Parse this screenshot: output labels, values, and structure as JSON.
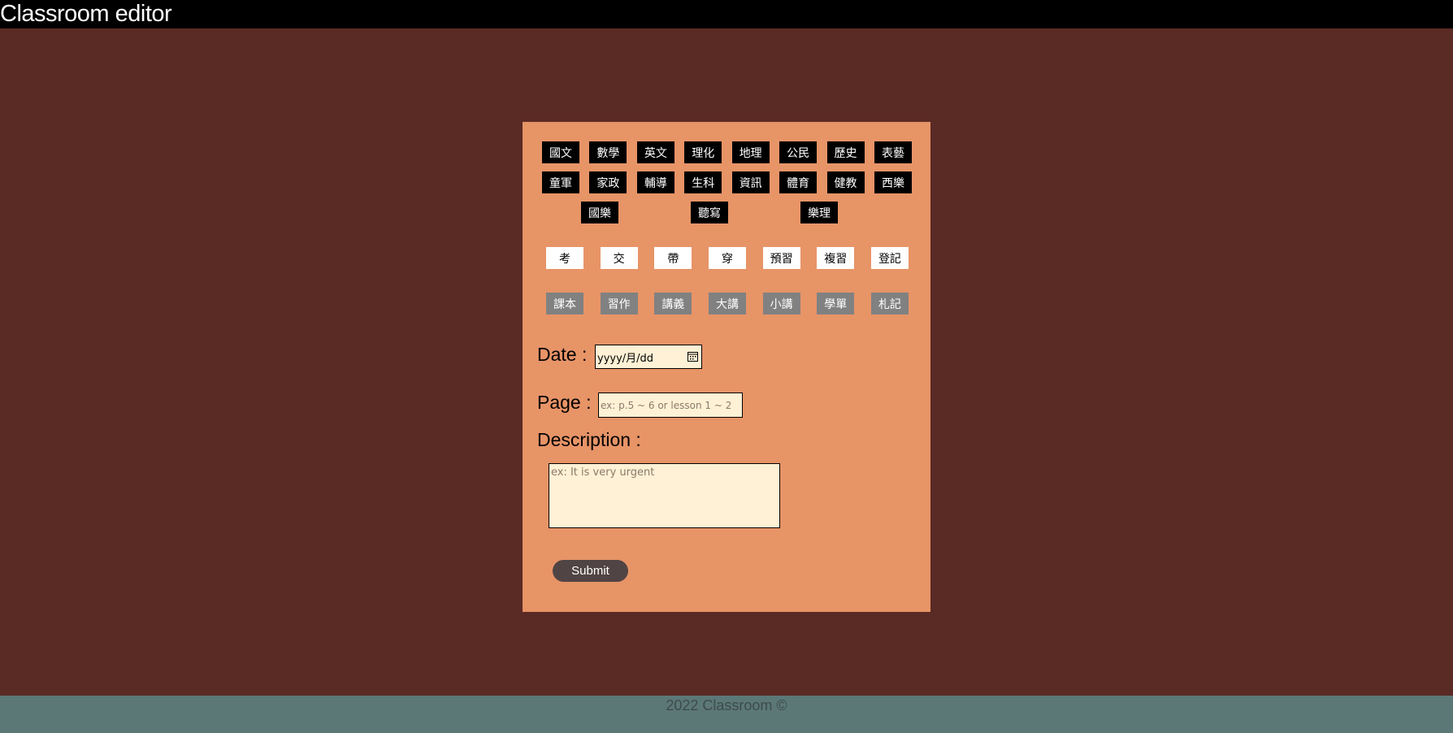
{
  "header": {
    "title": "Classroom editor"
  },
  "subjects": {
    "row1": [
      "國文",
      "數學",
      "英文",
      "理化",
      "地理",
      "公民",
      "歷史",
      "表藝"
    ],
    "row2": [
      "童軍",
      "家政",
      "輔導",
      "生科",
      "資訊",
      "體育",
      "健教",
      "西樂"
    ],
    "row3": [
      "國樂",
      "聽寫",
      "樂理"
    ]
  },
  "actions": [
    "考",
    "交",
    "帶",
    "穿",
    "預習",
    "複習",
    "登記"
  ],
  "items": [
    "課本",
    "習作",
    "講義",
    "大講",
    "小講",
    "學單",
    "札記"
  ],
  "form": {
    "date_label": "Date :",
    "date_value": "yyyy/月/dd",
    "page_label": "Page :",
    "page_placeholder": "ex: p.5 ~ 6 or lesson 1 ~ 2",
    "description_label": "Description :",
    "description_placeholder": "ex: It is very urgent",
    "submit_label": "Submit"
  },
  "footer": {
    "copyright": "2022 Classroom ©"
  },
  "colors": {
    "background": "#5a2a25",
    "panel": "#e79467",
    "header": "#000000",
    "footer": "#5b7877",
    "input_bg": "#fff1d5",
    "submit_bg": "#514444"
  }
}
